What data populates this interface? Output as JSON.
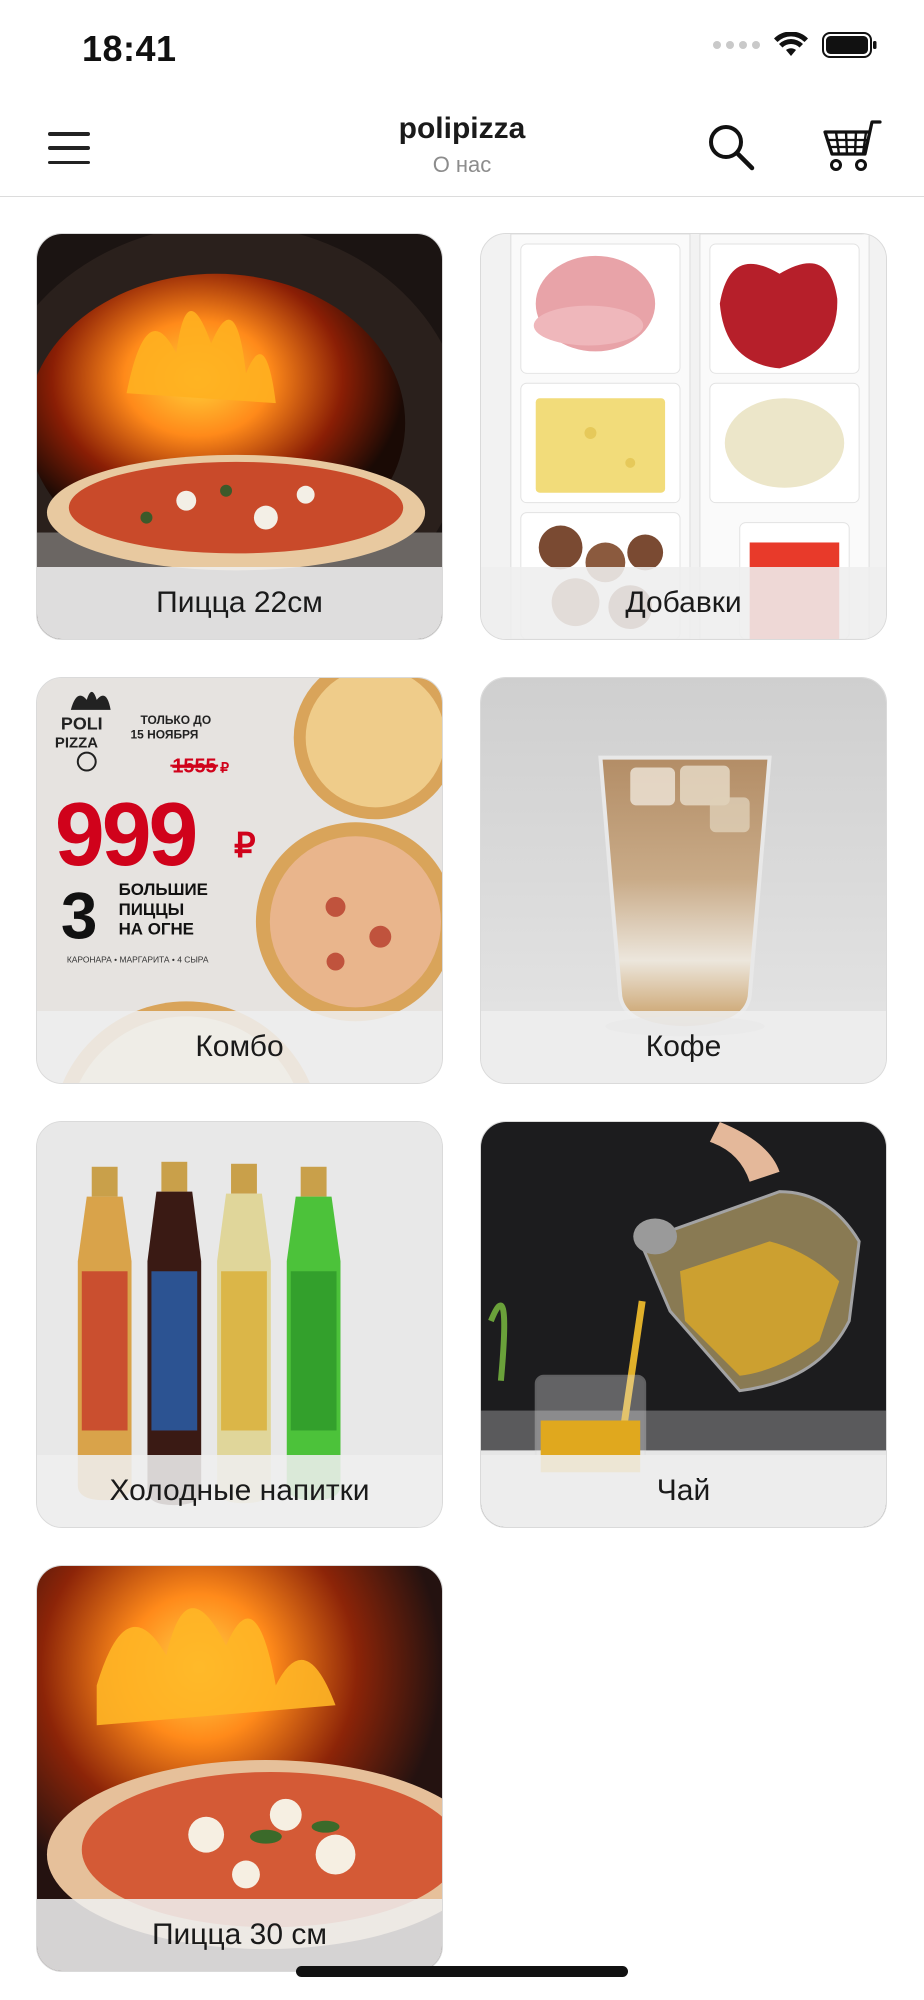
{
  "status_bar": {
    "time": "18:41",
    "icons": [
      "cellular-signal-icon",
      "wifi-icon",
      "battery-icon"
    ]
  },
  "nav": {
    "title": "polipizza",
    "subtitle": "О нас",
    "menu_icon": "hamburger-menu-icon",
    "search_icon": "search-icon",
    "cart_icon": "shopping-cart-icon"
  },
  "categories": [
    {
      "label": "Пицца 22см",
      "image": "pizza-in-wood-oven"
    },
    {
      "label": "Добавки",
      "image": "toppings-tray"
    },
    {
      "label": "Комбо",
      "image": "combo-promo-banner",
      "promo": {
        "brand_line1": "POLI",
        "brand_line2": "PIZZA",
        "until_line1": "ТОЛЬКО ДО",
        "until_line2": "15 НОЯБРЯ",
        "old_price": "1555",
        "old_price_currency": "₽",
        "new_price": "999",
        "currency": "₽",
        "count": "3",
        "desc_line1": "БОЛЬШИЕ",
        "desc_line2": "ПИЦЦЫ",
        "desc_line3": "НА ОГНЕ",
        "flavors": "КАРОНАРА • МАРГАРИТА • 4 СЫРА"
      }
    },
    {
      "label": "Кофе",
      "image": "iced-latte-glass"
    },
    {
      "label": "Холодные напитки",
      "image": "lemonade-bottles"
    },
    {
      "label": "Чай",
      "image": "tea-pouring"
    },
    {
      "label": "Пицца 30 см",
      "image": "pizza-fire-oven"
    }
  ],
  "colors": {
    "accent_red": "#d0021b",
    "label_bar": "#eeeeee",
    "divider": "#dcdcdc",
    "subtitle_gray": "#8c8c8c"
  }
}
